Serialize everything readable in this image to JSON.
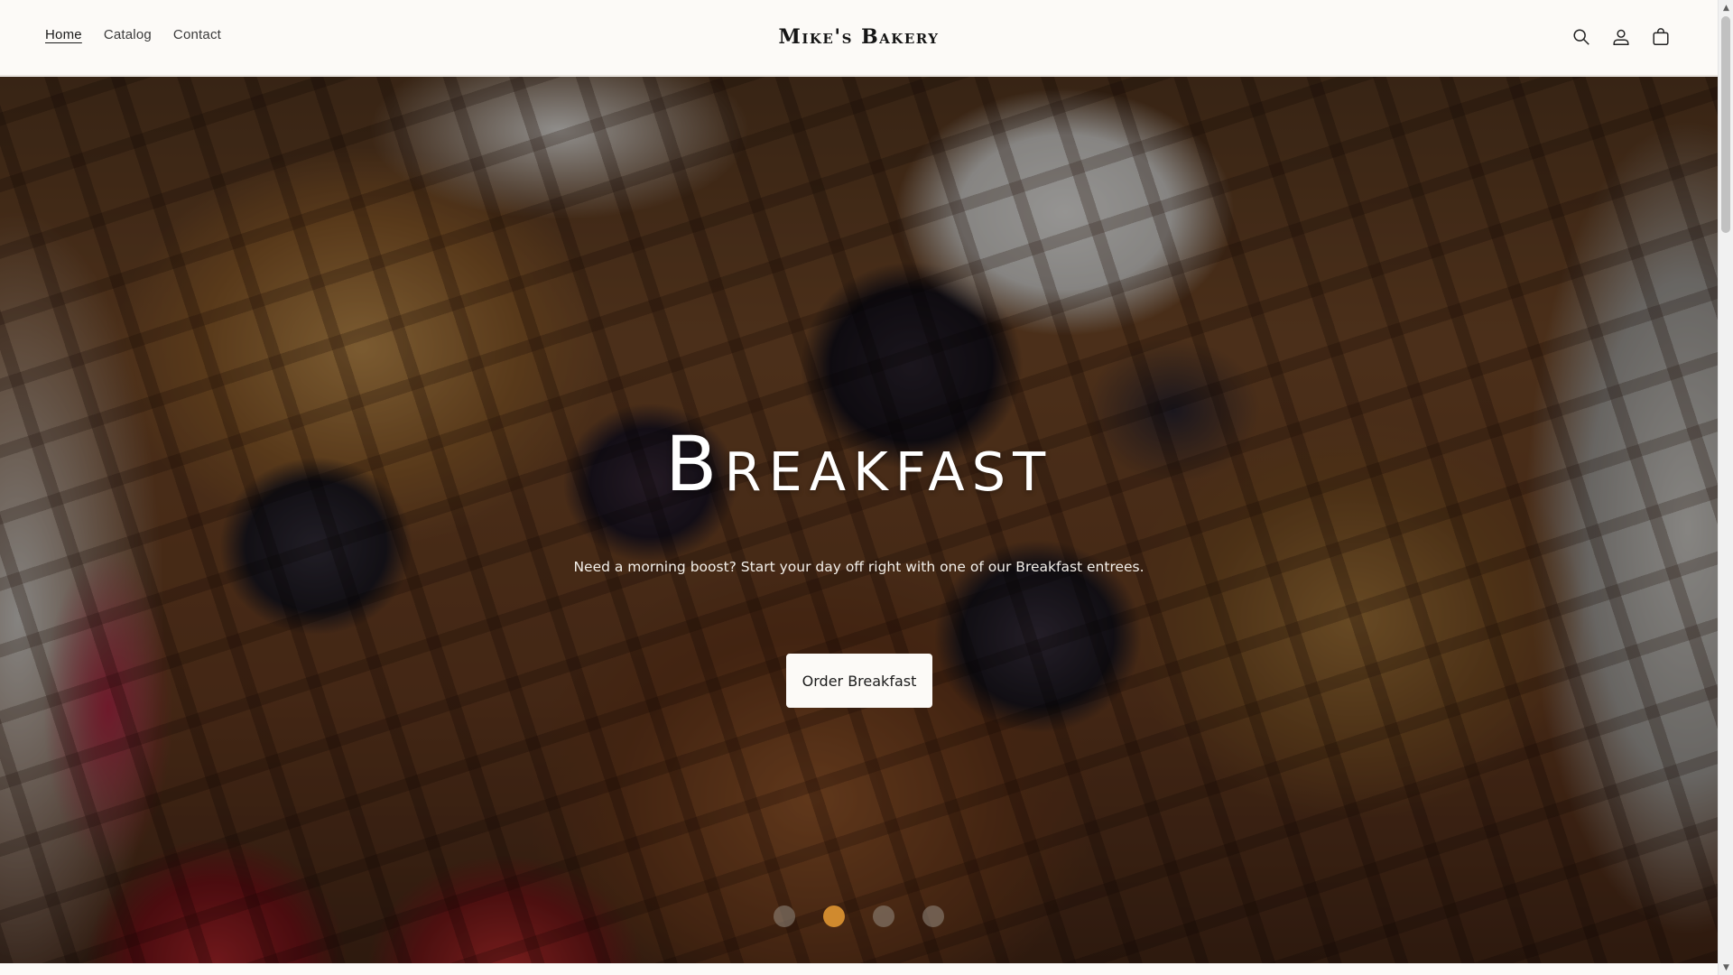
{
  "header": {
    "nav": [
      {
        "label": "Home",
        "active": true
      },
      {
        "label": "Catalog",
        "active": false
      },
      {
        "label": "Contact",
        "active": false
      }
    ],
    "logo": "Mike's Bakery",
    "icons": [
      "search-icon",
      "account-icon",
      "cart-icon"
    ]
  },
  "hero": {
    "title": "Breakfast",
    "subtitle": "Need a morning boost? Start your day off right with one of our Breakfast entrees.",
    "button_label": "Order Breakfast",
    "slides_total": 4,
    "active_slide": 2
  },
  "colors": {
    "background": "#fcfaf7",
    "accent_dot": "#d08a2e",
    "text": "#1c1c1c"
  }
}
